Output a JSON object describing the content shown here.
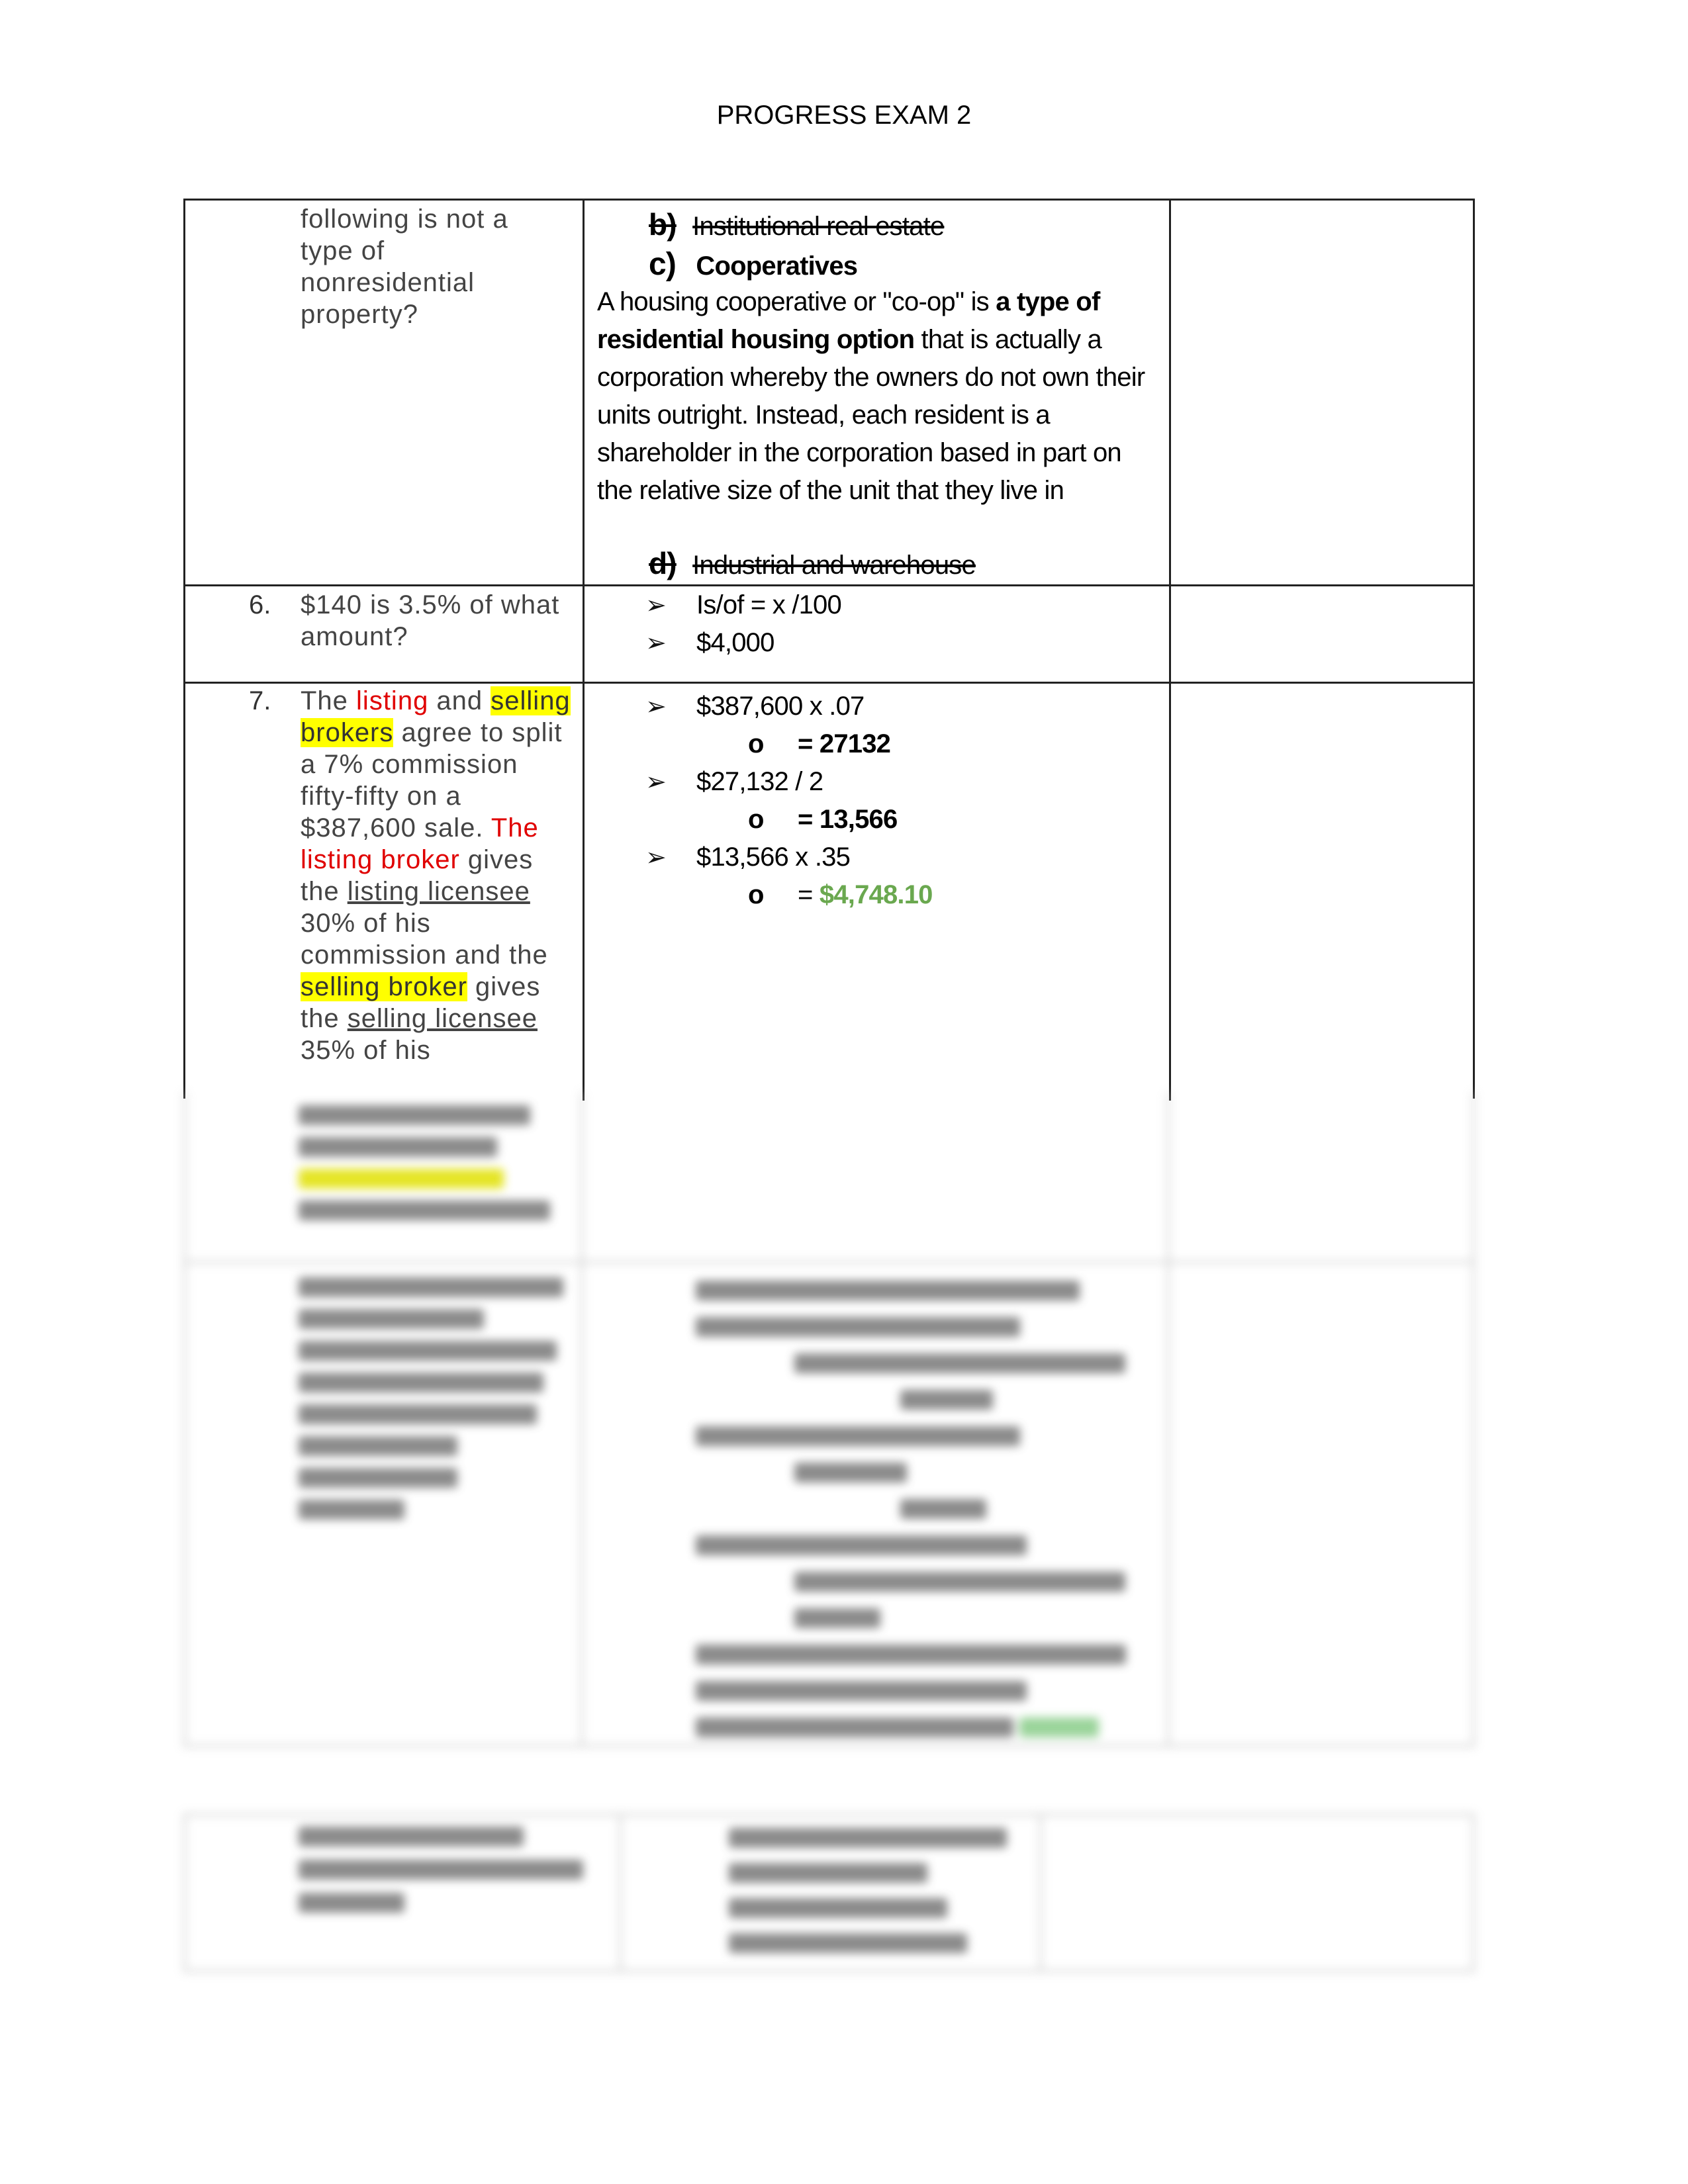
{
  "header": {
    "title": "PROGRESS EXAM 2"
  },
  "rows": [
    {
      "question_lines": [
        "following is not a",
        "type of",
        "nonresidential",
        "property?"
      ],
      "answer": {
        "option_b": {
          "letter": "b)",
          "text": "Institutional real estate"
        },
        "option_c": {
          "letter": "c)",
          "text": "Cooperatives"
        },
        "explanation": {
          "part1": "A housing cooperative or \"co-op\" is ",
          "bold": "a type of residential housing option",
          "part2": " that is actually a corporation whereby the owners do not own their units outright. Instead, each resident is a shareholder in the corporation based in part on the relative size of the unit that they live in"
        },
        "option_d": {
          "letter": "d)",
          "text": "Industrial and warehouse"
        }
      }
    },
    {
      "number": "6.",
      "question": "$140 is 3.5% of what amount?",
      "steps": [
        "Is/of = x /100",
        "$4,000"
      ]
    },
    {
      "number": "7.",
      "question_parts": {
        "t1": "The ",
        "t2": "listing",
        "t3": " and ",
        "t4": "selling brokers",
        "t5": " agree to split a 7% commission fifty-fifty on a $387,600 sale. ",
        "t6": "The listing broker",
        "t7": " gives the ",
        "t8": "listing licensee",
        "t9": " 30% of his commission and the ",
        "t10": "selling broker",
        "t11": " gives the ",
        "t12": "selling licensee",
        "t13": " 35% of his"
      },
      "steps": [
        {
          "text": "$387,600 x  .07",
          "result": "= 27132"
        },
        {
          "text": "$27,132 / 2",
          "result": "= 13,566"
        },
        {
          "text": "$13,566 x .35",
          "result_prefix": "= ",
          "result": "$4,748.10"
        }
      ],
      "sub_marker": "o"
    }
  ],
  "colors": {
    "red": "#e00000",
    "highlight": "#ffff00",
    "answer_green": "#6aa84f"
  },
  "icons": {
    "bullet": "arrowhead-bullet-icon"
  }
}
